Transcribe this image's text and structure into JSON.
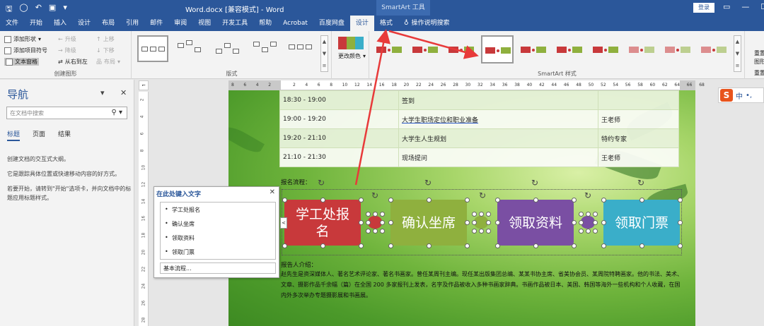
{
  "titlebar": {
    "doc_title": "Word.docx [兼容模式] - Word",
    "context_tab_title": "SmartArt 工具",
    "login_label": "登录",
    "qat_icons": [
      "save-icon",
      "autosave-icon",
      "undo-icon",
      "touch-mode-icon",
      "customize-icon"
    ],
    "qat_glyphs": [
      "🖫",
      "◯",
      "↶",
      "▣",
      "▾"
    ],
    "win_glyphs": [
      "▭",
      "—",
      "☐"
    ]
  },
  "tabs": [
    "文件",
    "开始",
    "插入",
    "设计",
    "布局",
    "引用",
    "邮件",
    "审阅",
    "视图",
    "开发工具",
    "帮助",
    "Acrobat",
    "百度网盘",
    "设计",
    "格式"
  ],
  "active_tab_index": 13,
  "tell_me": "操作说明搜索",
  "ribbon": {
    "create_group": {
      "label": "创建图形",
      "add_shape": "添加形状",
      "add_bullet": "添加项目符号",
      "text_pane": "文本窗格",
      "promote": "升级",
      "demote": "降级",
      "right_to_left": "从右到左",
      "move_up": "上移",
      "move_down": "下移",
      "layout": "布局"
    },
    "layouts_group": {
      "label": "版式"
    },
    "change_colors": "更改颜色",
    "styles_group": {
      "label": "SmartArt 样式"
    },
    "reset_group": {
      "reset": "重置",
      "graphic": "图形",
      "reset2": "重置"
    }
  },
  "nav": {
    "title": "导航",
    "search_placeholder": "在文档中搜索",
    "tabs": [
      "标题",
      "页面",
      "结果"
    ],
    "text1": "创建文档的交互式大纲。",
    "text2": "它是跟踪具体位置或快速移动内容的好方式。",
    "text3": "若要开始，请转到\"开始\"选项卡，并向文档中的标题应用标题样式。"
  },
  "ruler": {
    "h_numbers": [
      "8",
      "6",
      "4",
      "2",
      "",
      "2",
      "4",
      "6",
      "8",
      "10",
      "12",
      "14",
      "16",
      "18",
      "20",
      "22",
      "24",
      "26",
      "28",
      "30",
      "32",
      "34",
      "36",
      "38",
      "40",
      "42",
      "44",
      "46",
      "48",
      "50",
      "52",
      "54",
      "56",
      "58",
      "60",
      "62",
      "64",
      "66",
      "68"
    ],
    "v_numbers": [
      "2",
      "4",
      "6",
      "8",
      "10",
      "12",
      "14",
      "16",
      "18",
      "20",
      "22",
      "24",
      "26",
      "28"
    ]
  },
  "schedule": [
    [
      "18:30 - 19:00",
      "签到",
      ""
    ],
    [
      "19:00 - 19:20",
      "大学生职场定位和职业准备",
      "王老师"
    ],
    [
      "19:20 - 21:10",
      "大学生人生规划",
      "特约专家"
    ],
    [
      "21:10 - 21:30",
      "现场提问",
      "王老师"
    ]
  ],
  "process_label": "报名流程：",
  "smartart": {
    "steps": [
      "学工处报名",
      "确认坐席",
      "领取资料",
      "领取门票"
    ],
    "colors": [
      "#c8393b",
      "#8fb03e",
      "#7a4fa3",
      "#3aaec9"
    ]
  },
  "speaker_label": "报告人介绍：",
  "speaker_bio": "赵先生是资深媒体人、著名艺术评论家、著名书画家。曾任某周刊主编。现任某出版集团总编、某某书协主席、省美协会员、某周院特聘画家。他的书法、美术、文章、摄影作品千余幅（篇）在全国 200 多家报刊上发表，名字及作品被收入多种书画家辞典。书画作品被日本、美国、韩国等海外一些机构和个人收藏，在国内外多次举办专题摄影展和书画展。",
  "text_pane": {
    "title": "在此处键入文字",
    "items": [
      "学工处报名",
      "确认坐席",
      "领取资料",
      "领取门票"
    ],
    "footer": "基本流程..."
  },
  "ime": {
    "mode": "中",
    "extra": "•,"
  },
  "accent_color": "#2b579a",
  "annotation_color": "#e83a3a"
}
